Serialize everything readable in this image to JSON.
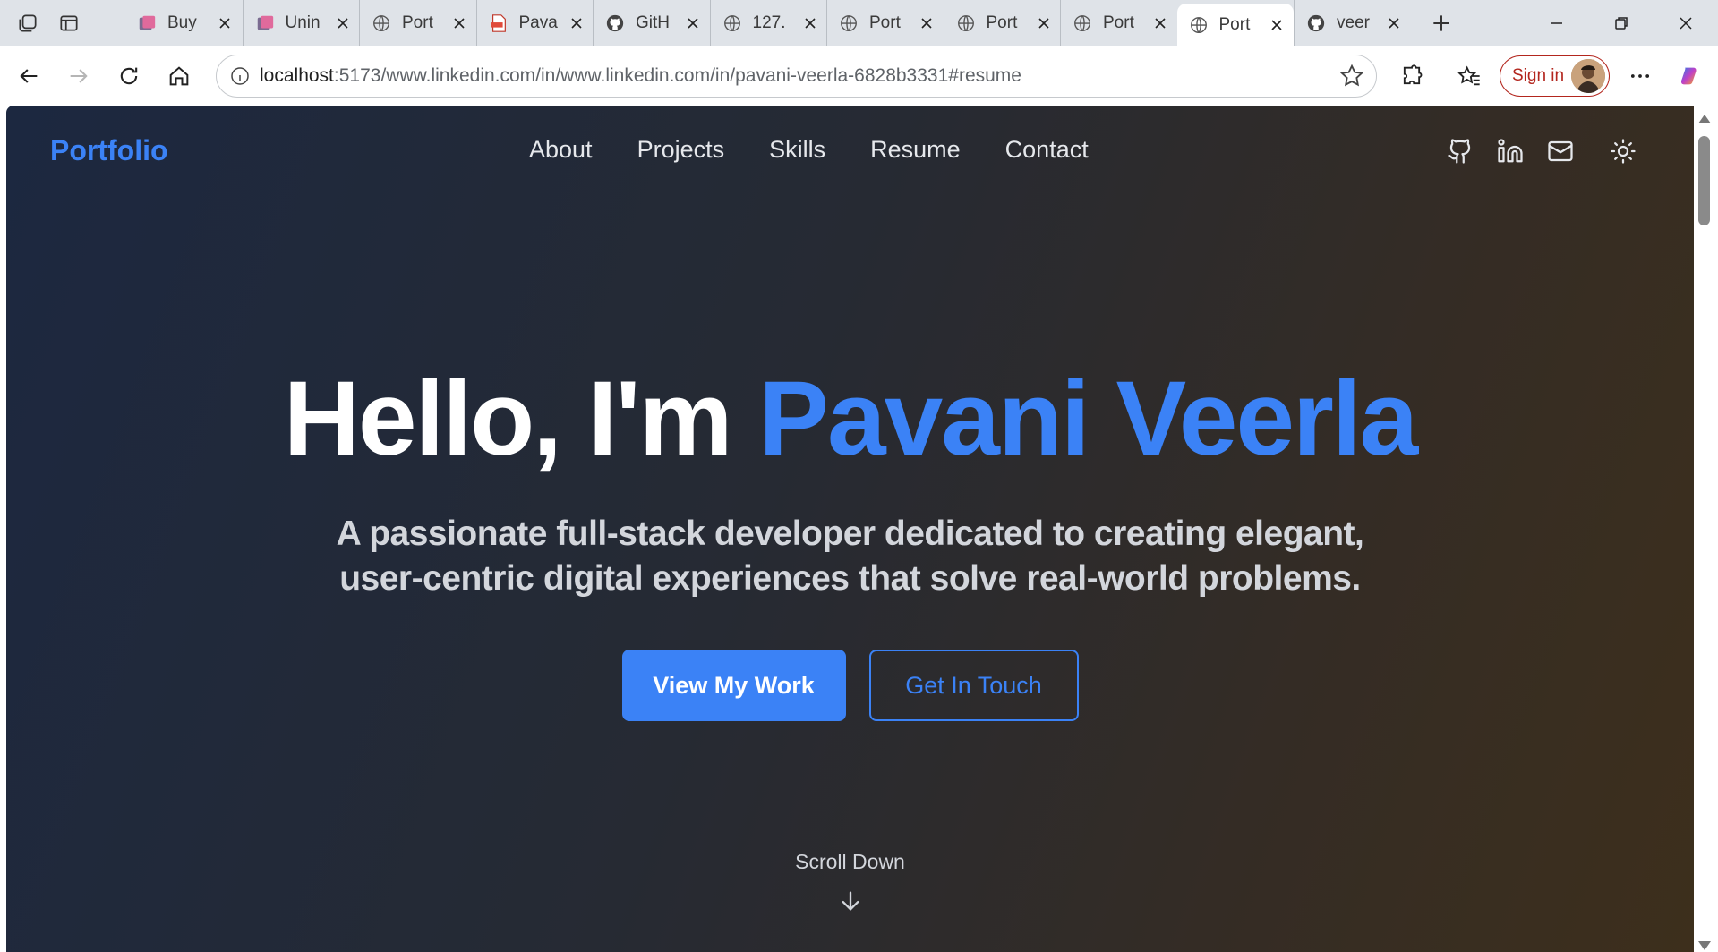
{
  "browser": {
    "tabs": [
      {
        "title": "Buy",
        "icon": "pink-app-icon"
      },
      {
        "title": "Unin",
        "icon": "pink-app-icon"
      },
      {
        "title": "Port",
        "icon": "globe-icon"
      },
      {
        "title": "Pava",
        "icon": "pdf-icon"
      },
      {
        "title": "GitH",
        "icon": "github-icon"
      },
      {
        "title": "127.",
        "icon": "globe-icon"
      },
      {
        "title": "Port",
        "icon": "globe-icon"
      },
      {
        "title": "Port",
        "icon": "globe-icon"
      },
      {
        "title": "Port",
        "icon": "globe-icon"
      },
      {
        "title": "Port",
        "icon": "globe-icon",
        "active": true
      },
      {
        "title": "veer",
        "icon": "github-icon"
      }
    ],
    "url_host": "localhost",
    "url_rest": ":5173/www.linkedin.com/in/www.linkedin.com/in/pavani-veerla-6828b3331#resume",
    "sign_in_label": "Sign in"
  },
  "site": {
    "logo": "Portfolio",
    "nav": [
      "About",
      "Projects",
      "Skills",
      "Resume",
      "Contact"
    ],
    "social_icons": [
      "github-icon",
      "linkedin-icon",
      "mail-icon",
      "sun-icon"
    ],
    "hero": {
      "greeting": "Hello, I'm ",
      "name": "Pavani Veerla",
      "tagline": "A passionate full-stack developer dedicated to creating elegant, user-centric digital experiences that solve real-world problems.",
      "primary_cta": "View My Work",
      "secondary_cta": "Get In Touch"
    },
    "scroll_label": "Scroll Down"
  },
  "colors": {
    "accent": "#3b82f6",
    "bg_left": "#1c2840",
    "bg_right": "#3d2f1c"
  }
}
